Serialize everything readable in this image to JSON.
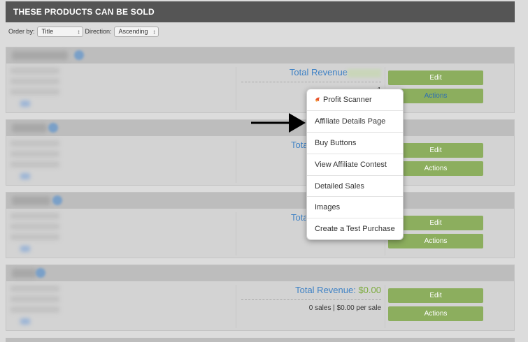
{
  "header": {
    "title": "THESE PRODUCTS CAN BE SOLD"
  },
  "sort": {
    "order_by_label": "Order by:",
    "order_by_value": "Title",
    "direction_label": "Direction:",
    "direction_value": "Ascending"
  },
  "products": [
    {
      "revenue_label": "Total Revenue",
      "revenue_amount": "",
      "sales_text": "1",
      "edit_label": "Edit",
      "actions_label": "Actions"
    },
    {
      "revenue_label": "Tota",
      "revenue_amount": "",
      "sales_text": "",
      "edit_label": "Edit",
      "actions_label": "Actions"
    },
    {
      "revenue_label": "Tota",
      "revenue_amount": "",
      "sales_text": "",
      "edit_label": "Edit",
      "actions_label": "Actions"
    },
    {
      "revenue_label": "Total Revenue: ",
      "revenue_amount": "$0.00",
      "sales_text": "0 sales | $0.00 per sale",
      "edit_label": "Edit",
      "actions_label": "Actions"
    }
  ],
  "menu": {
    "items": [
      {
        "label": "Profit Scanner",
        "icon": "profit-scanner-icon"
      },
      {
        "label": "Affiliate Details Page"
      },
      {
        "label": "Buy Buttons"
      },
      {
        "label": "View Affiliate Contest"
      },
      {
        "label": "Detailed Sales"
      },
      {
        "label": "Images"
      },
      {
        "label": "Create a Test Purchase"
      }
    ]
  },
  "colors": {
    "header_bg": "#555555",
    "button_green": "#8cae5e",
    "link_blue": "#3f82c5",
    "amount_green": "#7cab3e"
  }
}
